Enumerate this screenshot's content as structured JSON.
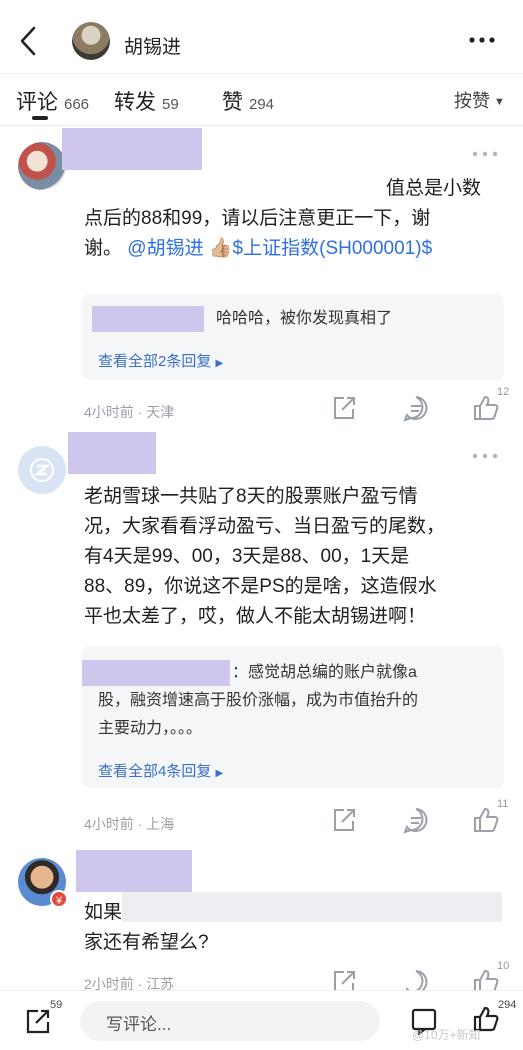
{
  "header": {
    "author_name": "胡锡进"
  },
  "tabs": {
    "comments_label": "评论",
    "comments_count": "666",
    "reposts_label": "转发",
    "reposts_count": "59",
    "likes_label": "赞",
    "likes_count": "294",
    "sort_label": "按赞"
  },
  "comments": [
    {
      "text_line1": "值总是小数",
      "text_line2": "点后的88和99，请以后注意更正一下，谢",
      "text_line3_prefix": "谢。",
      "mention": "@胡锡进",
      "emoji": "👍🏼",
      "stock_tag": "$上证指数(SH000001)$",
      "reply_preview": "哈哈哈，被你发现真相了",
      "view_all": "查看全部2条回复",
      "meta": "4小时前 · 天津",
      "like_count": "12"
    },
    {
      "text_line1": "老胡雪球一共贴了8天的股票账户盈亏情",
      "text_line2": "况，大家看看浮动盈亏、当日盈亏的尾数，",
      "text_line3": "有4天是99、00，3天是88、00，1天是",
      "text_line4": "88、89，你说这不是PS的是啥，这造假水",
      "text_line5": "平也太差了，哎，做人不能太胡锡进啊！",
      "reply_preview_line1": "：感觉胡总编的账户就像a",
      "reply_preview_line2": "股，融资增速高于股价涨幅，成为市值抬升的",
      "reply_preview_line3": "主要动力，。。。",
      "view_all": "查看全部4条回复",
      "meta": "4小时前 · 上海",
      "like_count": "11"
    },
    {
      "badge": "¥",
      "text_line1": "如果",
      "text_line2": "家还有希望么?",
      "meta": "2小时前 · 江苏",
      "like_count": "10"
    }
  ],
  "bottom_bar": {
    "repost_count": "59",
    "write_placeholder": "写评论...",
    "like_count": "294",
    "watermark": "@10万+新知"
  }
}
